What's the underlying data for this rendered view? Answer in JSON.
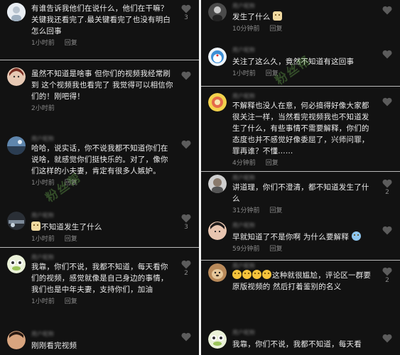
{
  "left": {
    "comments": [
      {
        "username": "",
        "text": "有谁告诉我他们在说什么，他们在干嘛？关键我还看完了.最关键看完了也没有明白怎么回事",
        "time": "1小时前",
        "reply": "回复",
        "likes": "3"
      },
      {
        "username": "",
        "text": "虽然不知道是啥事 但你们的视频我经常刷到 这个视频我也看完了 我觉得可以相信你们的！刚吧得！",
        "time": "2小时前",
        "reply": "",
        "likes": ""
      },
      {
        "username": "",
        "text": "哈哈，说实话，你不说我都不知道你们在说啥，就感觉你们挺快乐的。对了，像你们这样的小夫妻，肯定有很多人嫉妒。",
        "time": "1小时前",
        "reply": "回复",
        "likes": ""
      },
      {
        "username": "",
        "text": "不知道发生了什么",
        "time": "1小时前",
        "reply": "回复",
        "likes": "3"
      },
      {
        "username": "",
        "text": "我靠，你们不说，我都不知道，每天看你们的视频，感觉就像是自己身边的事情，我们也是中年夫妻，支持你们，加油",
        "time": "1小时前",
        "reply": "回复",
        "likes": "2"
      },
      {
        "username": "",
        "text": "刚刚看完视频",
        "time": "",
        "reply": "",
        "likes": ""
      }
    ]
  },
  "right": {
    "comments": [
      {
        "username": "",
        "text": "发生了什么",
        "time": "10分钟前",
        "reply": "回复",
        "likes": ""
      },
      {
        "username": "",
        "text": "关注了这么久，竟然不知道有这回事",
        "time": "1小时前",
        "reply": "回复",
        "likes": ""
      },
      {
        "username": "",
        "text": "不解释也没人在意，何必搞得好像大家都很关注一样，当然看完视频我也不知道发生了什么，有些事情不需要解释，你们的态度也并不感觉好像委屈了，兴师问罪，罪再谁？不懂......",
        "time": "4分钟前",
        "reply": "回复",
        "likes": ""
      },
      {
        "username": "",
        "text": "讲道理，你们不澄清，都不知道发生了什么",
        "time": "31分钟前",
        "reply": "回复",
        "likes": "2"
      },
      {
        "username": "",
        "text": "早就知道了不是你啊 为什么要解释",
        "time": "59分钟前",
        "reply": "回复",
        "likes": ""
      },
      {
        "username": "",
        "text": "这种就很尴尬，评论区一群要原版视频的 然后打着鉴别的名义",
        "time": "",
        "reply": "",
        "likes": "2"
      },
      {
        "username": "",
        "text": "我靠，你们不说，我都不知道，每天看",
        "time": "",
        "reply": "",
        "likes": ""
      }
    ]
  },
  "watermark": "粉丝帮",
  "colors": {
    "background": "#121212",
    "text": "#ececec",
    "meta": "#8a8a8a",
    "separator": "#d8d8d8"
  }
}
